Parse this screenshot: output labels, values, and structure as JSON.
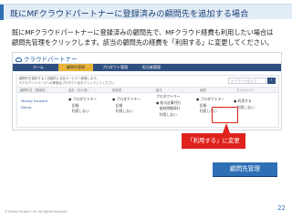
{
  "slide": {
    "title": "既にMFクラウドパートナーに登録済みの顧問先を追加する場合",
    "lead_lines": [
      "既にMFクラウドパートナーに登録済みの顧問先で、MFクラウド経費も利用したい場合は",
      "顧問先管理をクリックします。該当の顧問先の経費を「利用する」に変更してください。"
    ],
    "callout": "「利用する」に変更",
    "section_label": "顧問先管理",
    "copyright": "© Money Forward, Inc. All Rights Reserved",
    "page_number": "22"
  },
  "app": {
    "logo_text": "クラウドパートナー",
    "nav_tabs": [
      "ホーム",
      "顧問先管理",
      "プロダクト管理",
      "担当者管理"
    ],
    "panel_note_lines": [
      "顧問先を選択すると自動的に当社サービスへ移動します。",
      "※アカウントページへの移動はプロダクト名をクリックしてください"
    ],
    "search_placeholder": "キーワードを入力",
    "search_button": "›",
    "table_headers": [
      "顧問先名（登録名）",
      "会計（法人用）",
      "請求書",
      "給与",
      "経費",
      "マイナンバー"
    ],
    "row": {
      "name_lines": [
        "Money Forward",
        "Demo"
      ],
      "accounting": [
        "● プロダクトキー",
        "　記帳",
        "　利用しない"
      ],
      "invoice": [
        "● プロダクトキー",
        "　記帳",
        "　利用しない"
      ],
      "payroll": [
        "プロダクトキー",
        "● 給与計算代行",
        "　給料明細発行",
        "　利用しない"
      ],
      "expense": [
        "● プロダクトキー",
        "　記帳",
        "　利用しない"
      ],
      "mynumber": [
        "● 利用する",
        "　利用しない"
      ]
    }
  }
}
